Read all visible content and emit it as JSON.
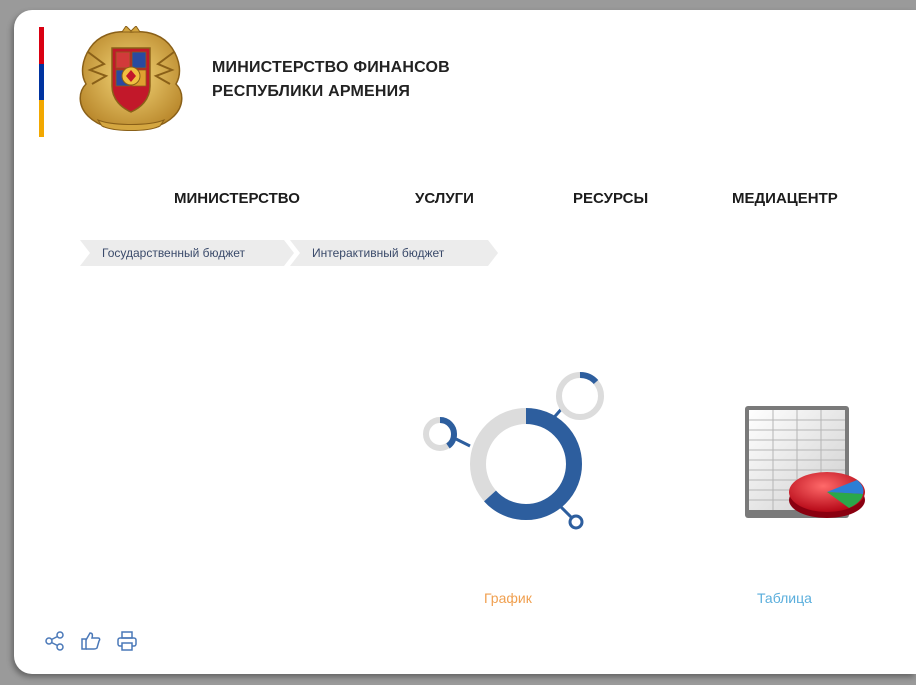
{
  "header": {
    "title_line1": "МИНИСТЕРСТВО ФИНАНСОВ",
    "title_line2": "РЕСПУБЛИКИ АРМЕНИЯ",
    "flag_colors": [
      "#d90012",
      "#0033a0",
      "#f2a800"
    ],
    "emblem": "coat-of-arms-emblem"
  },
  "nav": {
    "items": [
      {
        "label": "МИНИСТЕРСТВО"
      },
      {
        "label": "УСЛУГИ"
      },
      {
        "label": "РЕСУРСЫ"
      },
      {
        "label": "МЕДИАЦЕНТР"
      }
    ]
  },
  "breadcrumb": {
    "items": [
      {
        "label": "Государственный бюджет"
      },
      {
        "label": "Интерактивный бюджет"
      }
    ]
  },
  "options": {
    "graph": {
      "label": "График",
      "color": "#f0a050",
      "icon": "donut-chart-icon"
    },
    "table": {
      "label": "Таблица",
      "color": "#5aaedc",
      "icon": "spreadsheet-pie-icon"
    }
  },
  "actions": {
    "icons": [
      "share-icon",
      "like-icon",
      "print-icon"
    ],
    "color": "#4a78b8"
  },
  "colors": {
    "accent_blue": "#2d5e9e",
    "ring_gray": "#dcdcdc"
  }
}
